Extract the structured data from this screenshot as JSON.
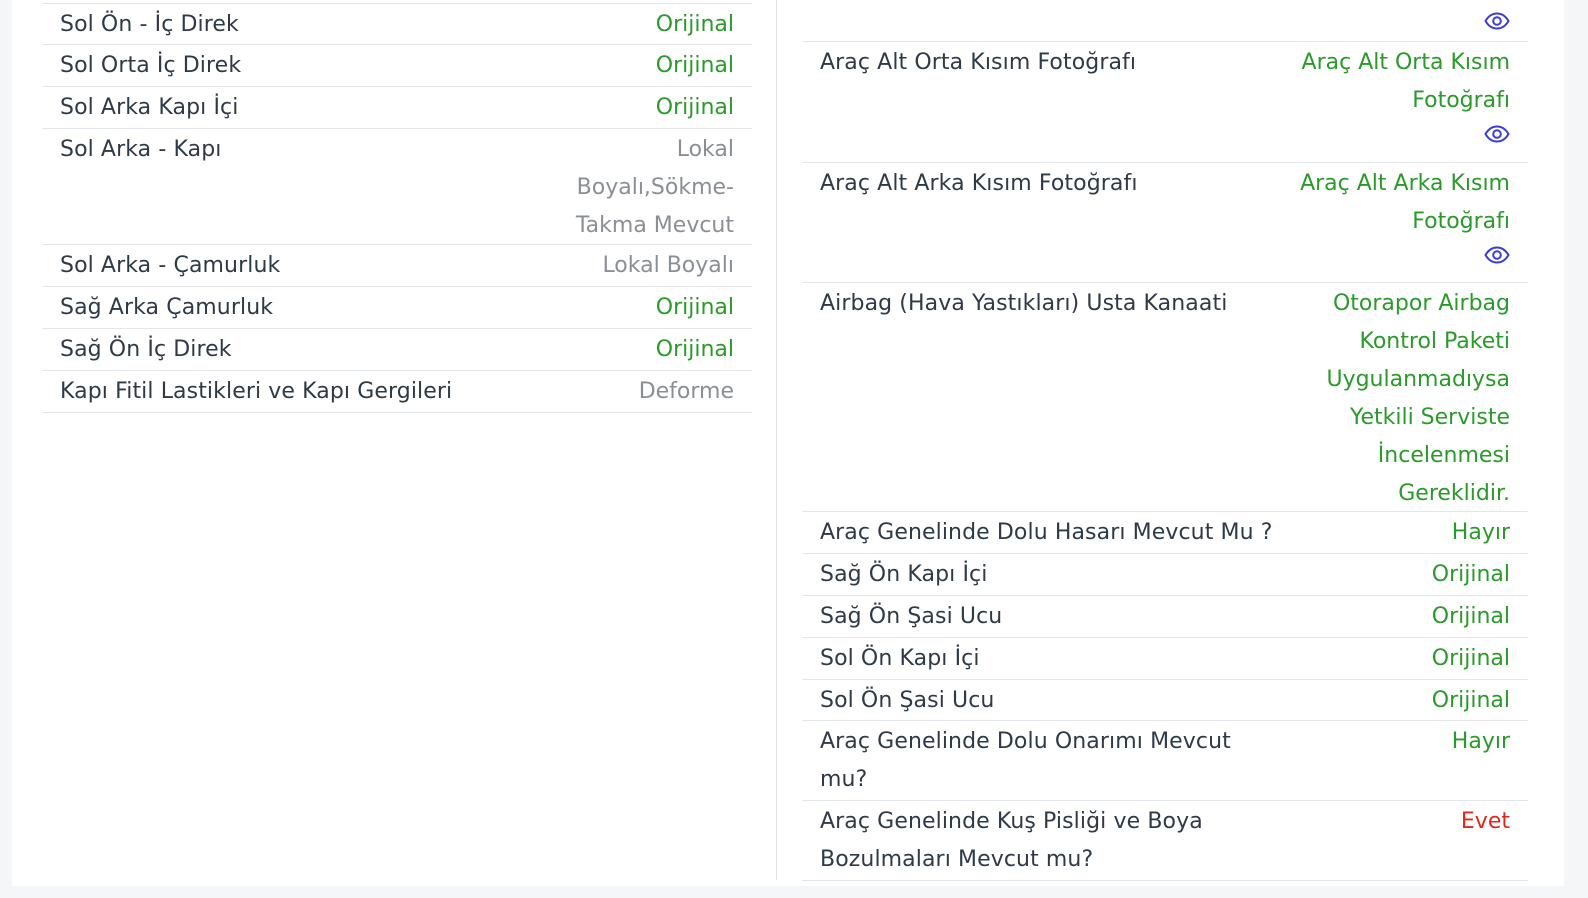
{
  "left_rows": [
    {
      "label": "Sol Ön - İç Direk",
      "value": "Orijinal",
      "status": "green"
    },
    {
      "label": "Sol Orta İç Direk",
      "value": "Orijinal",
      "status": "green"
    },
    {
      "label": "Sol Arka Kapı İçi",
      "value": "Orijinal",
      "status": "green"
    },
    {
      "label": "Sol Arka - Kapı",
      "value": "Lokal Boyalı,Sökme-Takma Mevcut",
      "status": "gray"
    },
    {
      "label": "Sol Arka - Çamurluk",
      "value": "Lokal Boyalı",
      "status": "gray"
    },
    {
      "label": "Sağ Arka Çamurluk",
      "value": "Orijinal",
      "status": "green"
    },
    {
      "label": "Sağ Ön İç Direk",
      "value": "Orijinal",
      "status": "green"
    },
    {
      "label": "Kapı Fitil Lastikleri ve Kapı Gergileri",
      "value": "Deforme",
      "status": "gray"
    }
  ],
  "right_rows": [
    {
      "label": "Araç Alt Orta Kısım Fotoğrafı",
      "value": "Araç Alt Orta Kısım Fotoğrafı",
      "status": "green",
      "icon": "eye-icon"
    },
    {
      "label": "Araç Alt Arka Kısım Fotoğrafı",
      "value": "Araç Alt Arka Kısım Fotoğrafı",
      "status": "green",
      "icon": "eye-icon"
    },
    {
      "label": "Airbag (Hava Yastıkları) Usta Kanaati",
      "value": "Otorapor Airbag Kontrol Paketi Uygulanmadıysa Yetkili Serviste İncelenmesi Gereklidir.",
      "status": "green"
    },
    {
      "label": "Araç Genelinde Dolu Hasarı Mevcut Mu ?",
      "value": "Hayır",
      "status": "green"
    },
    {
      "label": "Sağ Ön Kapı İçi",
      "value": "Orijinal",
      "status": "green"
    },
    {
      "label": "Sağ Ön Şasi Ucu",
      "value": "Orijinal",
      "status": "green"
    },
    {
      "label": "Sol Ön Kapı İçi",
      "value": "Orijinal",
      "status": "green"
    },
    {
      "label": "Sol Ön Şasi Ucu",
      "value": "Orijinal",
      "status": "green"
    },
    {
      "label": "Araç Genelinde Dolu Onarımı Mevcut mu?",
      "value": "Hayır",
      "status": "green"
    },
    {
      "label": "Araç Genelinde Kuş Pisliği ve Boya Bozulmaları Mevcut mu?",
      "value": "Evet",
      "status": "red"
    }
  ],
  "colors": {
    "green": "#2a9a2a",
    "gray": "#8a8f96",
    "red": "#e0281f",
    "label": "#2e3a48",
    "eye": "#3b3fd1"
  }
}
